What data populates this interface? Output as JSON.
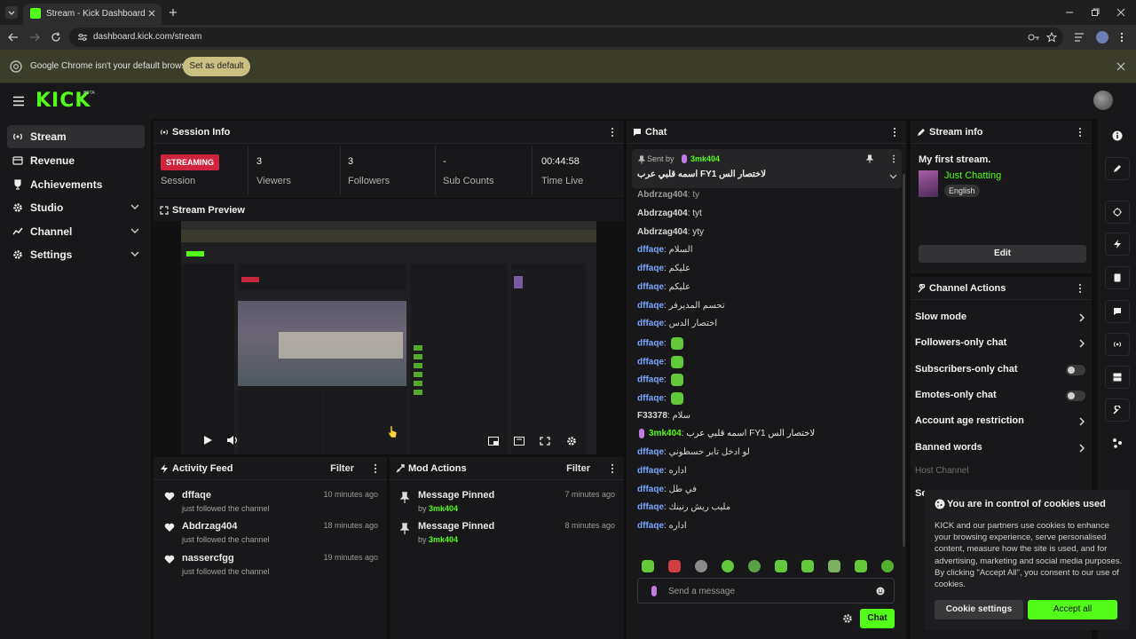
{
  "browser": {
    "tab_title": "Stream - Kick Dashboard",
    "url": "dashboard.kick.com/stream",
    "infobar_text": "Google Chrome isn't your default browser",
    "infobar_button": "Set as default"
  },
  "app": {
    "logo": "KICK",
    "logo_badge": "BETA"
  },
  "sidebar": {
    "items": [
      {
        "label": "Stream",
        "icon": "broadcast-icon",
        "active": true
      },
      {
        "label": "Revenue",
        "icon": "revenue-icon"
      },
      {
        "label": "Achievements",
        "icon": "trophy-icon"
      },
      {
        "label": "Studio",
        "icon": "gear-icon",
        "expandable": true
      },
      {
        "label": "Channel",
        "icon": "channel-icon",
        "expandable": true
      },
      {
        "label": "Settings",
        "icon": "settings-icon",
        "expandable": true
      }
    ]
  },
  "session": {
    "title": "Session Info",
    "badge": "STREAMING",
    "badge_label": "Session",
    "stats": [
      {
        "value": "3",
        "label": "Viewers"
      },
      {
        "value": "3",
        "label": "Followers"
      },
      {
        "value": "-",
        "label": "Sub Counts"
      },
      {
        "value": "00:44:58",
        "label": "Time Live"
      }
    ]
  },
  "preview": {
    "title": "Stream Preview"
  },
  "activity": {
    "title": "Activity Feed",
    "filter": "Filter",
    "items": [
      {
        "name": "dffaqe",
        "desc": "just followed the channel",
        "time": "10 minutes ago"
      },
      {
        "name": "Abdrzag404",
        "desc": "just followed the channel",
        "time": "18 minutes ago"
      },
      {
        "name": "nassercfgg",
        "desc": "just followed the channel",
        "time": "19 minutes ago"
      }
    ]
  },
  "mod": {
    "title": "Mod Actions",
    "filter": "Filter",
    "items": [
      {
        "name": "Message Pinned",
        "by": "by",
        "user": "3mk404",
        "time": "7 minutes ago"
      },
      {
        "name": "Message Pinned",
        "by": "by",
        "user": "3mk404",
        "time": "8 minutes ago"
      }
    ]
  },
  "chat": {
    "title": "Chat",
    "pinned": {
      "sent_by": "Sent by",
      "user": "3mk404",
      "text": "اسمه قلبي عرب FY1 لاختصار الس"
    },
    "messages": [
      {
        "user": "Abdrzag404",
        "text": "tyt",
        "color": "gray",
        "emote": false
      },
      {
        "user": "Abdrzag404",
        "text": "yty",
        "color": "gray",
        "emote": false
      },
      {
        "user": "dffaqe",
        "text": "السلام",
        "color": "blue",
        "emote": false
      },
      {
        "user": "dffaqe",
        "text": "عليكم",
        "color": "blue",
        "emote": false
      },
      {
        "user": "dffaqe",
        "text": "عليكم",
        "color": "blue",
        "emote": false
      },
      {
        "user": "dffaqe",
        "text": "تحسم المديرفر",
        "color": "blue",
        "emote": false
      },
      {
        "user": "dffaqe",
        "text": "اختصار الدس",
        "color": "blue",
        "emote": false
      },
      {
        "user": "dffaqe",
        "text": "",
        "color": "blue",
        "emote": true
      },
      {
        "user": "dffaqe",
        "text": "",
        "color": "blue",
        "emote": true
      },
      {
        "user": "dffaqe",
        "text": "",
        "color": "blue",
        "emote": true
      },
      {
        "user": "dffaqe",
        "text": "",
        "color": "blue",
        "emote": true
      },
      {
        "user": "F33378",
        "text": "سلام",
        "color": "gray",
        "emote": false
      },
      {
        "user": "3mk404",
        "text": "اسمه قلبي عرب FY1 لاختصار الس",
        "color": "green",
        "emote": false
      },
      {
        "user": "dffaqe",
        "text": "لو ادخل تابر حسطوني",
        "color": "blue",
        "emote": false
      },
      {
        "user": "dffaqe",
        "text": "اداره",
        "color": "blue",
        "emote": false
      },
      {
        "user": "dffaqe",
        "text": "في طل",
        "color": "blue",
        "emote": false
      },
      {
        "user": "dffaqe",
        "text": "مليب ريش رنينك",
        "color": "blue",
        "emote": false
      },
      {
        "user": "dffaqe",
        "text": "اداره",
        "color": "blue",
        "emote": false
      }
    ],
    "input_placeholder": "Send a message",
    "send_button": "Chat"
  },
  "stream_info": {
    "title": "Stream info",
    "stream_title": "My first stream.",
    "category": "Just Chatting",
    "language": "English",
    "edit_button": "Edit"
  },
  "channel_actions": {
    "title": "Channel Actions",
    "rows": [
      {
        "label": "Slow mode",
        "kind": "chevron"
      },
      {
        "label": "Followers-only chat",
        "kind": "chevron"
      },
      {
        "label": "Subscribers-only chat",
        "kind": "toggle",
        "on": false
      },
      {
        "label": "Emotes-only chat",
        "kind": "toggle",
        "on": false
      },
      {
        "label": "Account age restriction",
        "kind": "chevron"
      },
      {
        "label": "Banned words",
        "kind": "chevron"
      }
    ],
    "host_channel": "Host Channel",
    "partial_label": "Se"
  },
  "cookie": {
    "title": "You are in control of cookies used",
    "body": "KICK and our partners use cookies to enhance your browsing experience, serve personalised content, measure how the site is used, and for advertising, marketing and social media purposes. By clicking \"Accept All\", you consent to our use of cookies.",
    "settings_button": "Cookie settings",
    "accept_button": "Accept all"
  },
  "colors": {
    "brand_green": "#53fc18",
    "streaming_red": "#d0243d"
  }
}
